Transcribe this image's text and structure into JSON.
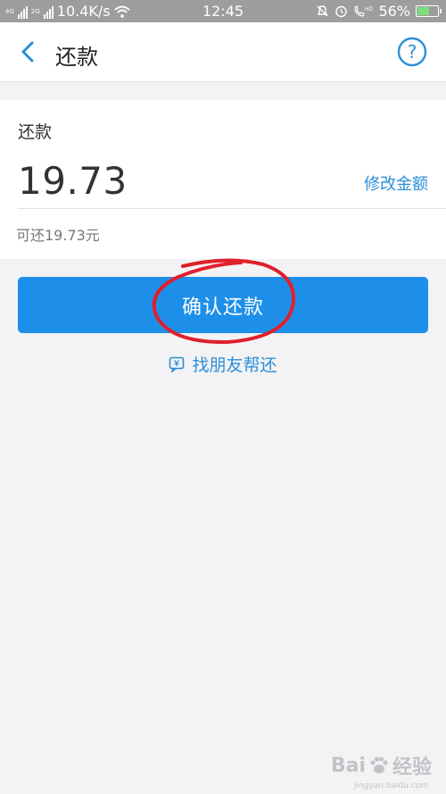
{
  "status_bar": {
    "network_speed": "10.4K/s",
    "time": "12:45",
    "battery": "56%",
    "sim1_label": "4G",
    "sim2_label": "2G"
  },
  "nav": {
    "title": "还款",
    "back_icon": "chevron-left-icon",
    "help_icon": "question-circle-icon"
  },
  "repay_card": {
    "label": "还款",
    "amount": "19.73",
    "edit_amount_label": "修改金额",
    "available_text": "可还19.73元"
  },
  "actions": {
    "confirm_label": "确认还款",
    "friend_help_label": "找朋友帮还"
  },
  "watermark": {
    "text_left": "Bai",
    "text_right": "经验",
    "url": "jingyan.baidu.com"
  },
  "colors": {
    "primary": "#1e8fe8",
    "link": "#2b8fd6",
    "annotation": "#e0202c"
  }
}
